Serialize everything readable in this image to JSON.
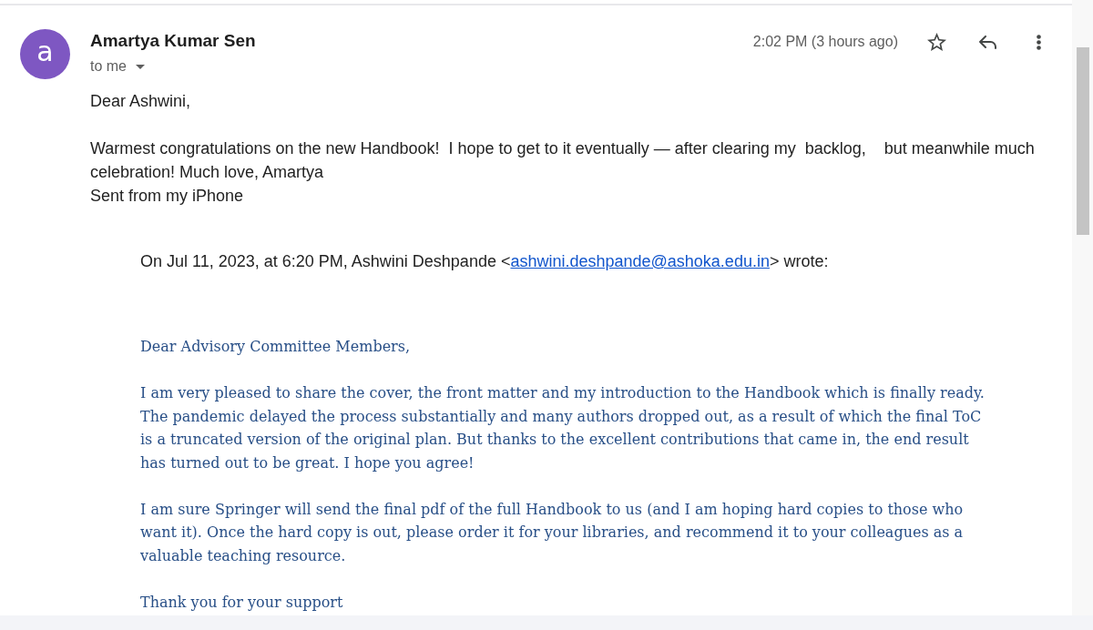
{
  "message": {
    "sender": {
      "initial": "a",
      "name": "Amartya Kumar Sen"
    },
    "recipients": {
      "label": "to me",
      "expanded": false
    },
    "time": "2:02 PM (3 hours ago)",
    "actions": [
      {
        "kind": "star",
        "starred": false
      },
      {
        "kind": "reply"
      },
      {
        "kind": "more"
      }
    ],
    "body": {
      "greeting": "Dear Ashwini,",
      "text": "Warmest congratulations on the new Handbook!  I hope to get to it eventually — after clearing my  backlog,    but meanwhile much celebration! Much love, Amartya",
      "signature": "Sent from my iPhone"
    },
    "quote": {
      "attribution": {
        "before": "On Jul 11, 2023, at 6:20 PM, Ashwini Deshpande <",
        "email": "ashwini.deshpande@ashoka.edu.in",
        "after": "> wrote:"
      },
      "greeting": "Dear Advisory Committee Members,",
      "paragraphs": [
        "I am very pleased to share the cover, the front matter and my introduction to the Handbook which is finally ready. The pandemic delayed the process substantially and many authors dropped out, as a result of which the final ToC is a truncated version of the original plan. But thanks to the excellent contributions that came in, the end result has turned out to be great. I hope you agree!",
        "I am sure Springer will send the final pdf of the full Handbook to us (and I am hoping hard copies to those who want it). Once the hard copy is out, please order it for your libraries, and recommend it to your colleagues as a valuable teaching resource.",
        "Thank you for your support"
      ]
    }
  }
}
